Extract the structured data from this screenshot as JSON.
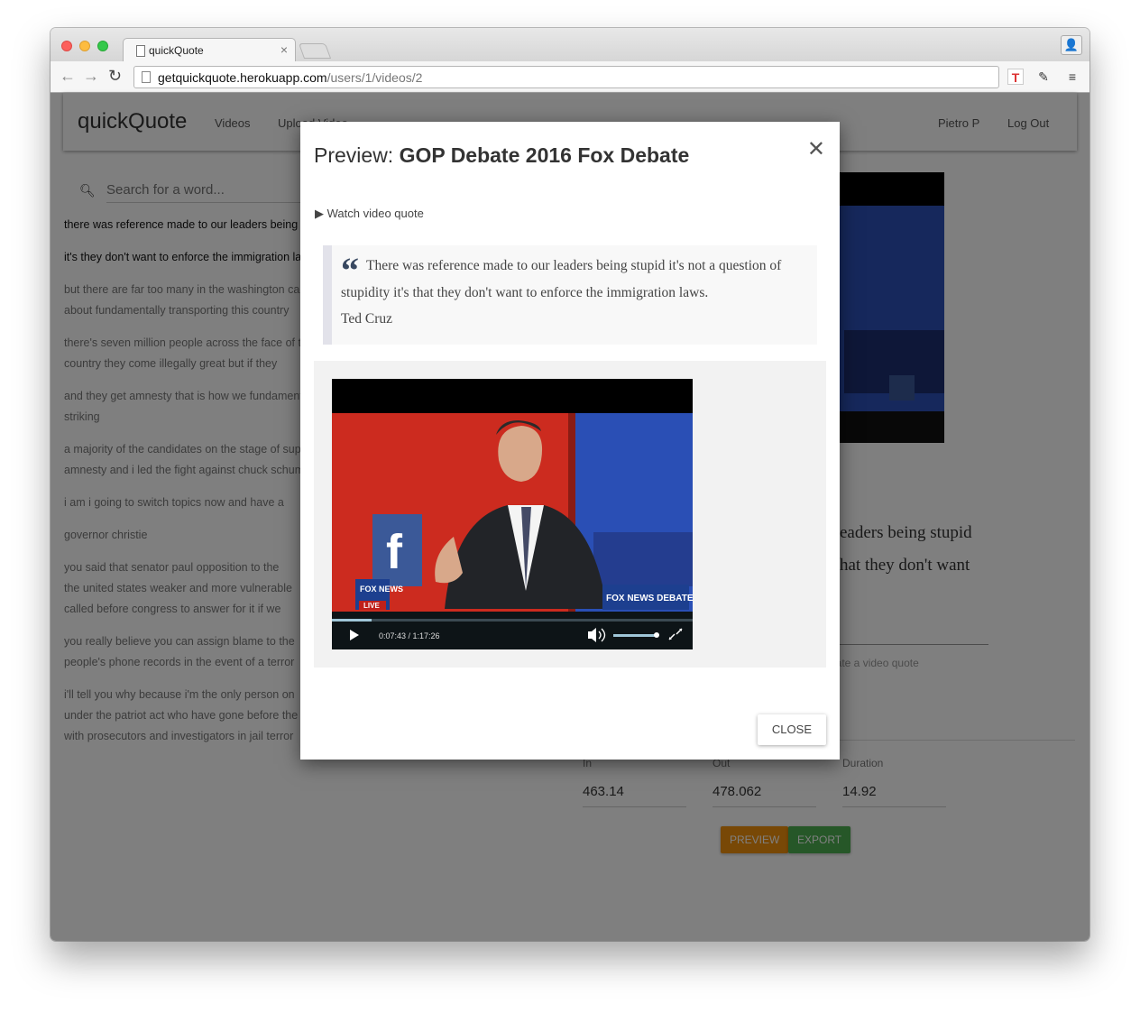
{
  "browser": {
    "tab_title": "quickQuote",
    "url_host": "getquickquote.herokuapp.com",
    "url_path": "/users/1/videos/2"
  },
  "navbar": {
    "brand": "quickQuote",
    "videos": "Videos",
    "upload": "Upload Video",
    "user": "Pietro P",
    "logout": "Log Out"
  },
  "search": {
    "placeholder": "Search for a word..."
  },
  "transcript": [
    "there was reference made to our leaders being stupid",
    "it's they don't want to enforce the immigration laws",
    "but there are far too many in the washington cartel",
    "about fundamentally transporting this country",
    "there's seven million people across the face of this",
    "country they come illegally great but if they",
    "and they get amnesty that is how we fundamentally",
    "striking",
    "a majority of the candidates on the stage of support",
    "amnesty and i led the fight against chuck schumer",
    "i am i going to switch topics now and have a",
    "governor christie",
    "you said that senator paul opposition to the",
    "the united states weaker and more vulnerable",
    "called before congress to answer for it if we",
    "you really believe you can assign blame to the",
    "people's phone records in the event of a terror",
    "i'll tell you why because i'm the only person on",
    "under the patriot act who have gone before the",
    "with prosecutors and investigators in jail terror"
  ],
  "background_quote": {
    "line1": "eaders being stupid",
    "line2": "hat they don't want"
  },
  "background_hint": "erate a video quote",
  "fields": {
    "in_label": "In",
    "in_value": "463.14",
    "out_label": "Out",
    "out_value": "478.062",
    "duration_label": "Duration",
    "duration_value": "14.92"
  },
  "buttons": {
    "preview": "PREVIEW",
    "export": "EXPORT"
  },
  "modal": {
    "title_prefix": "Preview:",
    "title_name": "GOP Debate 2016 Fox Debate",
    "watch": "Watch video quote",
    "quote_text": "There was reference made to our leaders being stupid it's not a question of stupidity it's that they don't want to enforce the immigration laws.",
    "quote_author": "Ted Cruz",
    "time": "0:07:43 / 1:17:26",
    "logo_news": "FOX NEWS",
    "logo_live": "LIVE",
    "logo_debate": "FOX NEWS DEBATE",
    "close": "CLOSE"
  },
  "colors": {
    "preview_btn": "#f0900c",
    "export_btn": "#4caf50",
    "quote_mark": "#384860"
  }
}
